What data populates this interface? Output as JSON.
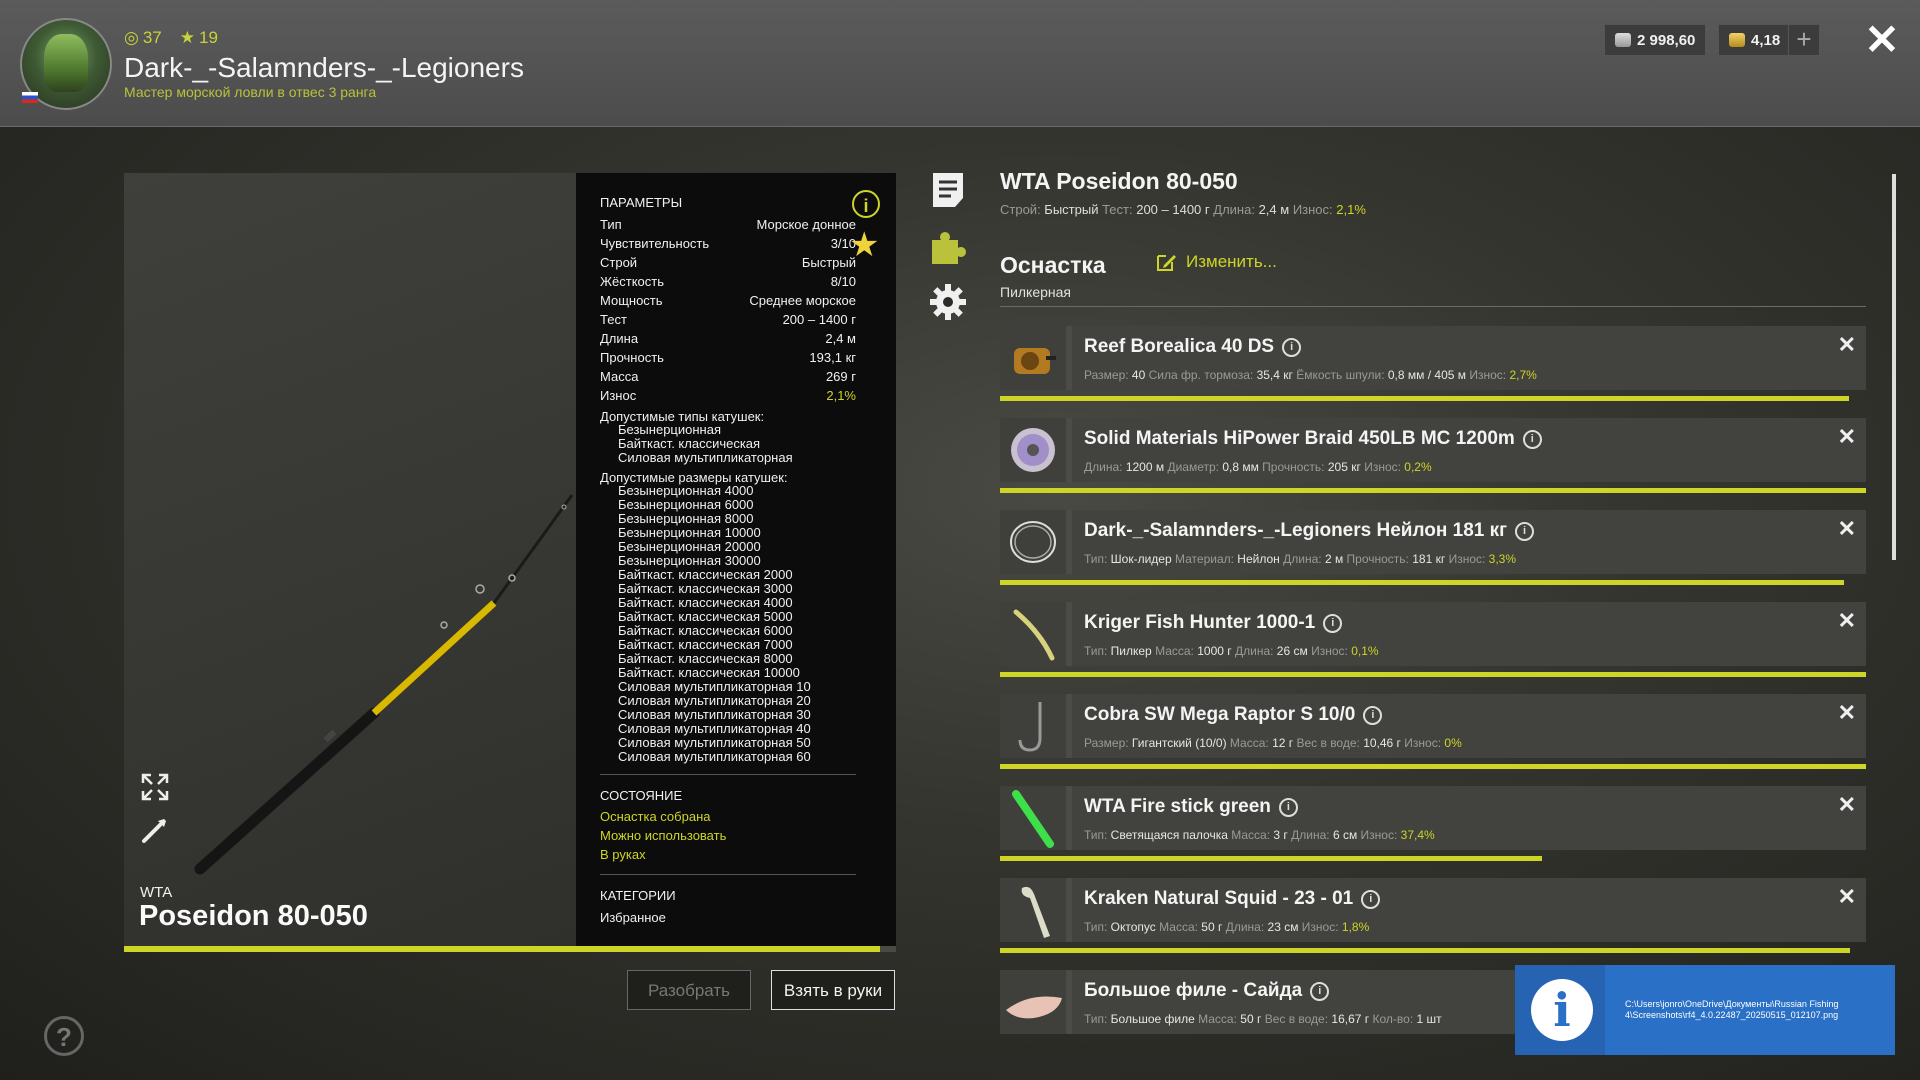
{
  "player": {
    "level": "37",
    "stars": "19",
    "name": "Dark-_-Salamnders-_-Legioners",
    "rank": "Мастер морской ловли в отвес 3 ранга"
  },
  "currency": {
    "silver": "2 998,60",
    "gold": "4,18"
  },
  "rod": {
    "brand": "WTA",
    "model": "Poseidon 80-050",
    "full_name": "WTA Poseidon 80-050",
    "wear_fraction": 0.979
  },
  "params": {
    "title": "ПАРАМЕТРЫ",
    "rows": [
      {
        "label": "Тип",
        "value": "Морское донное"
      },
      {
        "label": "Чувствительность",
        "value": "3/10"
      },
      {
        "label": "Строй",
        "value": "Быстрый"
      },
      {
        "label": "Жёсткость",
        "value": "8/10"
      },
      {
        "label": "Мощность",
        "value": "Среднее морское"
      },
      {
        "label": "Тест",
        "value": "200 – 1400 г"
      },
      {
        "label": "Длина",
        "value": "2,4 м"
      },
      {
        "label": "Прочность",
        "value": "193,1 кг"
      },
      {
        "label": "Масса",
        "value": "269 г"
      },
      {
        "label": "Износ",
        "value": "2,1%"
      }
    ],
    "reel_types_title": "Допустимые типы катушек:",
    "reel_types": [
      "Безынерционная",
      "Байткаст. классическая",
      "Силовая мультипликаторная"
    ],
    "reel_sizes_title": "Допустимые размеры катушек:",
    "reel_sizes": [
      "Безынерционная 4000",
      "Безынерционная 6000",
      "Безынерционная 8000",
      "Безынерционная 10000",
      "Безынерционная 20000",
      "Безынерционная 30000",
      "Байткаст. классическая 2000",
      "Байткаст. классическая 3000",
      "Байткаст. классическая 4000",
      "Байткаст. классическая 5000",
      "Байткаст. классическая 6000",
      "Байткаст. классическая 7000",
      "Байткаст. классическая 8000",
      "Байткаст. классическая 10000",
      "Силовая мультипликаторная 10",
      "Силовая мультипликаторная 20",
      "Силовая мультипликаторная 30",
      "Силовая мультипликаторная 40",
      "Силовая мультипликаторная 50",
      "Силовая мультипликаторная 60"
    ],
    "state_title": "СОСТОЯНИЕ",
    "state_items": [
      "Оснастка собрана",
      "Можно использовать",
      "В руках"
    ],
    "categories_title": "КАТЕГОРИИ",
    "categories": [
      "Избранное"
    ]
  },
  "buttons": {
    "disassemble": "Разобрать",
    "take": "Взять в руки"
  },
  "right": {
    "specs": [
      {
        "label": "Строй:",
        "value": "Быстрый"
      },
      {
        "label": "Тест:",
        "value": "200 – 1400 г"
      },
      {
        "label": "Длина:",
        "value": "2,4 м"
      },
      {
        "label": "Износ:",
        "value": "2,1%",
        "accent": true
      }
    ],
    "tackle_title": "Оснастка",
    "tackle_sub": "Пилкерная",
    "edit_label": "Изменить..."
  },
  "items": [
    {
      "name": "Reef Borealica 40 DS",
      "thumb": "reel-icon",
      "wear_fraction": 0.98,
      "details": [
        {
          "l": "Размер:",
          "v": "40"
        },
        {
          "l": "Сила фр. тормоза:",
          "v": "35,4 кг"
        },
        {
          "l": "Ёмкость шпули:",
          "v": "0,8 мм / 405 м"
        },
        {
          "l": "Износ:",
          "v": "2,7%",
          "a": true
        }
      ]
    },
    {
      "name": "Solid Materials HiPower Braid 450LB MC 1200m",
      "thumb": "line-spool-icon",
      "wear_fraction": 1.0,
      "details": [
        {
          "l": "Длина:",
          "v": "1200 м"
        },
        {
          "l": "Диаметр:",
          "v": "0,8 мм"
        },
        {
          "l": "Прочность:",
          "v": "205 кг"
        },
        {
          "l": "Износ:",
          "v": "0,2%",
          "a": true
        }
      ]
    },
    {
      "name": "Dark-_-Salamnders-_-Legioners Нейлон 181 кг",
      "thumb": "leader-icon",
      "wear_fraction": 0.975,
      "details": [
        {
          "l": "Тип:",
          "v": "Шок-лидер"
        },
        {
          "l": "Материал:",
          "v": "Нейлон"
        },
        {
          "l": "Длина:",
          "v": "2 м"
        },
        {
          "l": "Прочность:",
          "v": "181 кг"
        },
        {
          "l": "Износ:",
          "v": "3,3%",
          "a": true
        }
      ]
    },
    {
      "name": "Kriger Fish Hunter 1000-1",
      "thumb": "pilker-icon",
      "wear_fraction": 1.0,
      "details": [
        {
          "l": "Тип:",
          "v": "Пилкер"
        },
        {
          "l": "Масса:",
          "v": "1000 г"
        },
        {
          "l": "Длина:",
          "v": "26 см"
        },
        {
          "l": "Износ:",
          "v": "0,1%",
          "a": true
        }
      ]
    },
    {
      "name": "Cobra SW Mega Raptor S 10/0",
      "thumb": "hook-icon",
      "wear_fraction": 1.0,
      "details": [
        {
          "l": "Размер:",
          "v": "Гигантский (10/0)"
        },
        {
          "l": "Масса:",
          "v": "12 г"
        },
        {
          "l": "Вес в воде:",
          "v": "10,46 г"
        },
        {
          "l": "Износ:",
          "v": "0%",
          "a": true
        }
      ]
    },
    {
      "name": "WTA Fire stick green",
      "thumb": "glow-stick-icon",
      "wear_fraction": 0.626,
      "details": [
        {
          "l": "Тип:",
          "v": "Светящаяся палочка"
        },
        {
          "l": "Масса:",
          "v": "3 г"
        },
        {
          "l": "Длина:",
          "v": "6 см"
        },
        {
          "l": "Износ:",
          "v": "37,4%",
          "a": true
        }
      ]
    },
    {
      "name": "Kraken Natural Squid - 23 - 01",
      "thumb": "squid-icon",
      "wear_fraction": 0.982,
      "details": [
        {
          "l": "Тип:",
          "v": "Октопус"
        },
        {
          "l": "Масса:",
          "v": "50 г"
        },
        {
          "l": "Длина:",
          "v": "23 см"
        },
        {
          "l": "Износ:",
          "v": "1,8%",
          "a": true
        }
      ]
    },
    {
      "name": "Большое филе - Сайда",
      "thumb": "fillet-icon",
      "wear_fraction": null,
      "details": [
        {
          "l": "Тип:",
          "v": "Большое филе"
        },
        {
          "l": "Масса:",
          "v": "50 г"
        },
        {
          "l": "Вес в воде:",
          "v": "16,67 г"
        },
        {
          "l": "Кол-во:",
          "v": "1 шт"
        }
      ]
    }
  ],
  "toast": {
    "text": "C:\\Users\\jonro\\OneDrive\\Документы\\Russian Fishing 4\\Screenshots\\rf4_4.0.22487_20250515_012107.png"
  },
  "colors": {
    "accent": "#cdd527",
    "toast": "#2a70c6"
  }
}
